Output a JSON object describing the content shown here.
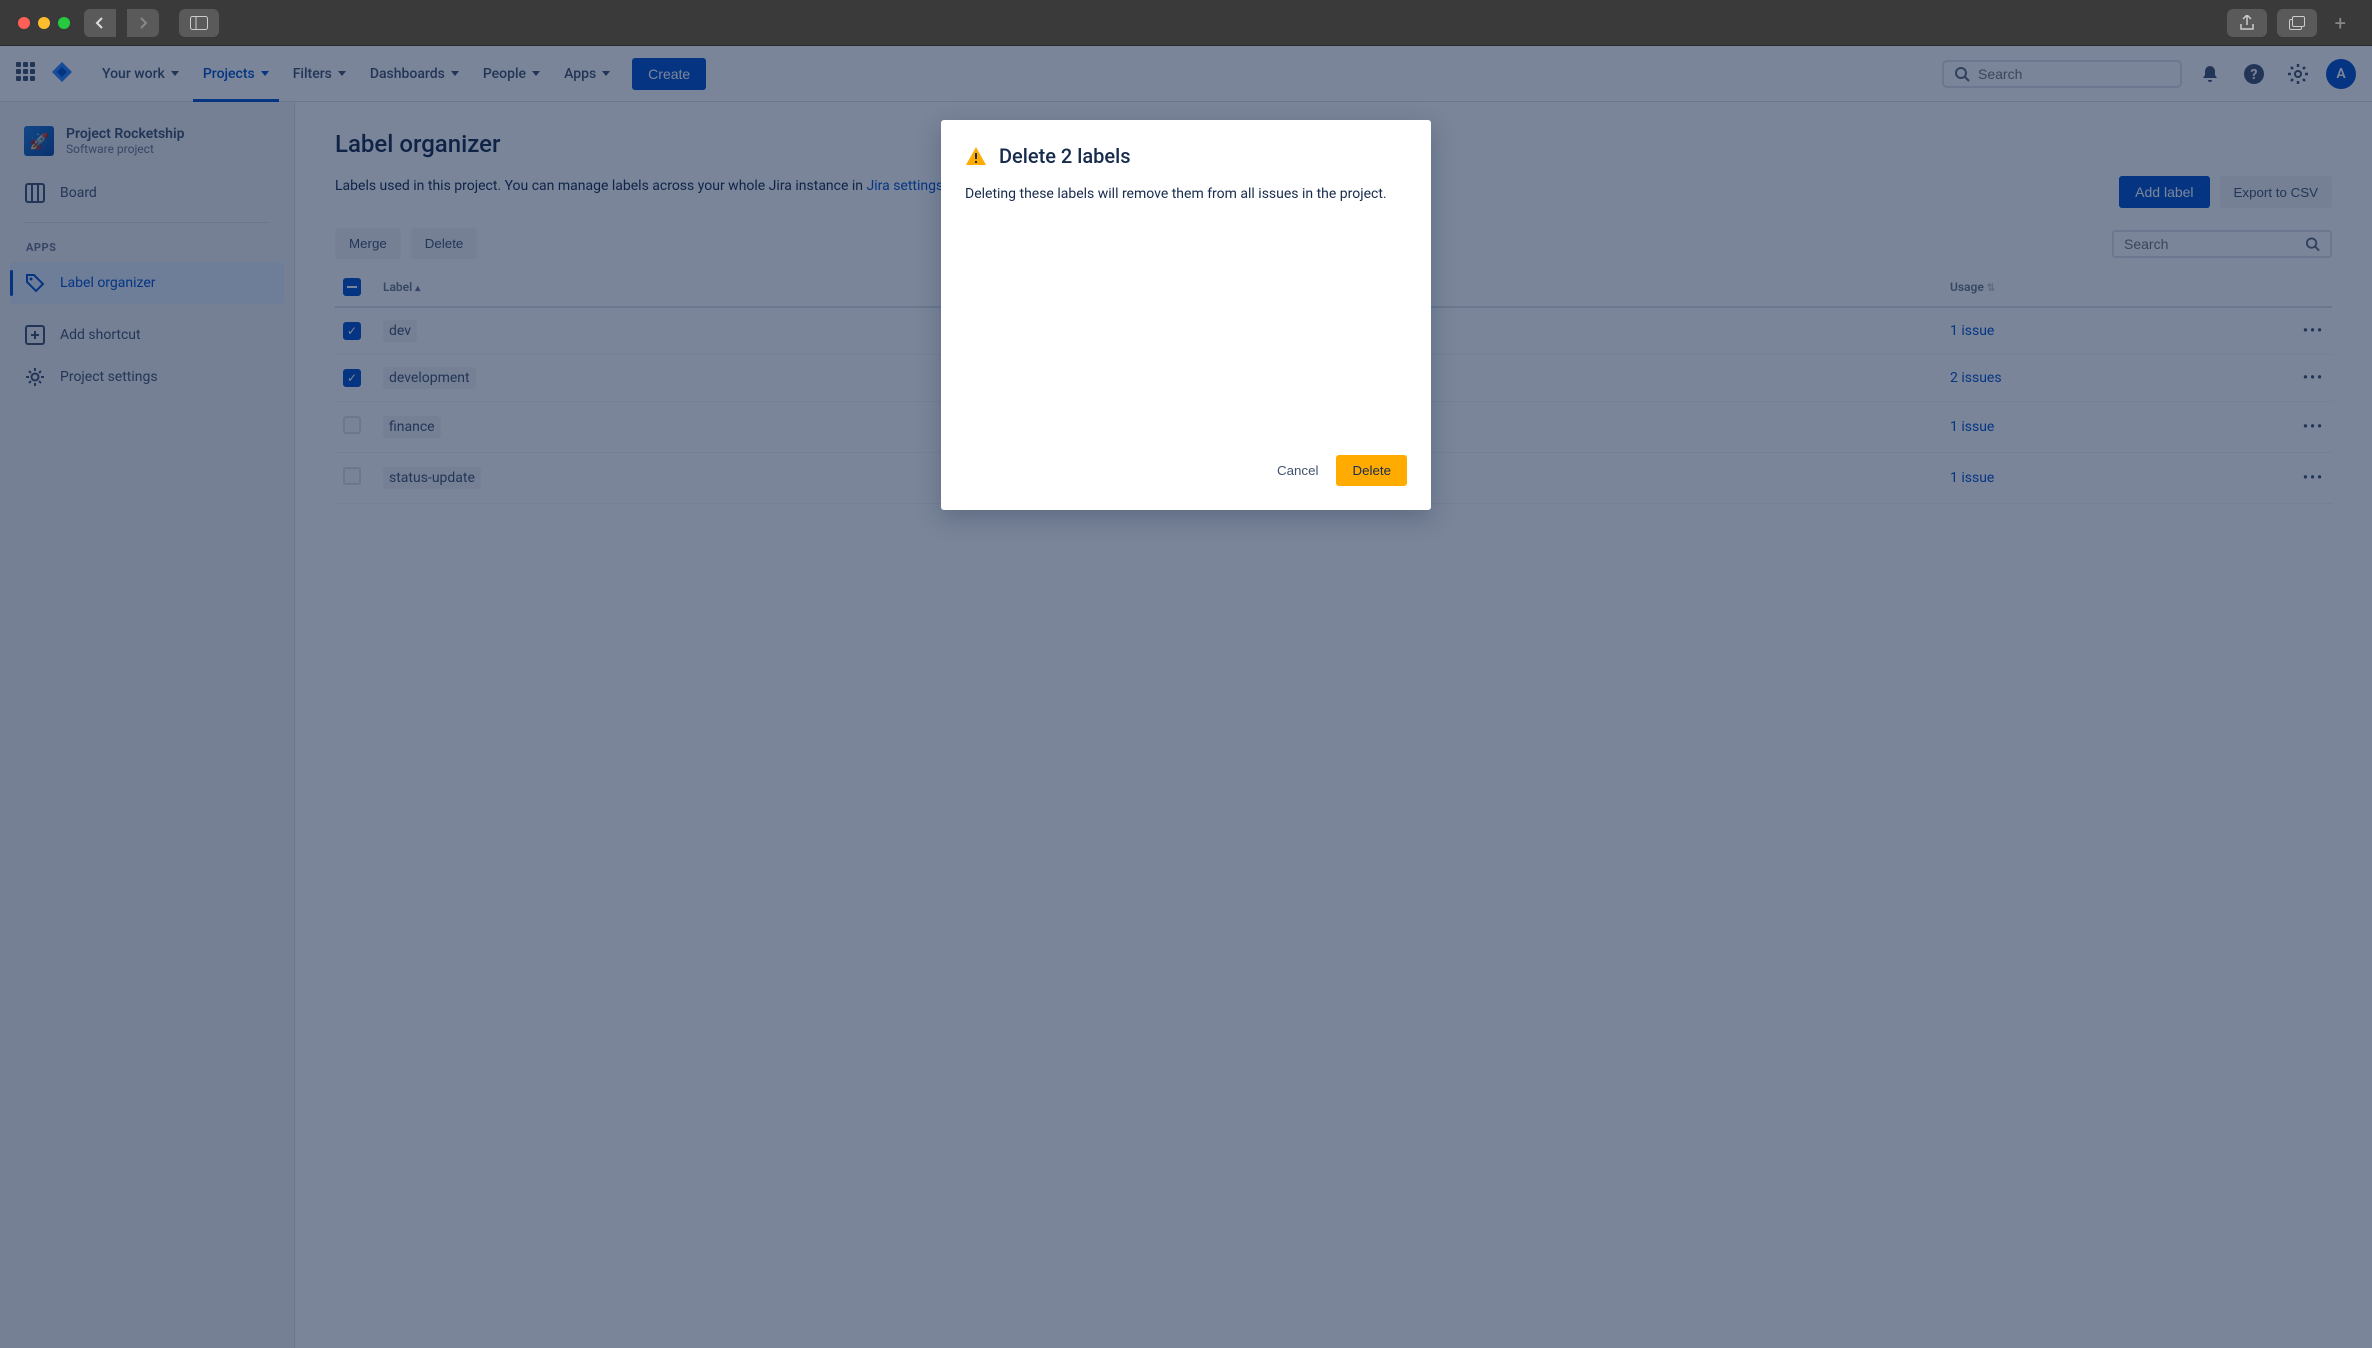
{
  "titlebar": {},
  "topnav": {
    "items": [
      {
        "label": "Your work"
      },
      {
        "label": "Projects"
      },
      {
        "label": "Filters"
      },
      {
        "label": "Dashboards"
      },
      {
        "label": "People"
      },
      {
        "label": "Apps"
      }
    ],
    "create_label": "Create",
    "search_placeholder": "Search",
    "avatar_initial": "A"
  },
  "sidebar": {
    "project_name": "Project Rocketship",
    "project_type": "Software project",
    "board_label": "Board",
    "apps_heading": "APPS",
    "label_organizer": "Label organizer",
    "add_shortcut": "Add shortcut",
    "project_settings": "Project settings"
  },
  "page": {
    "title": "Label organizer",
    "desc_prefix": "Labels used in this project. You can manage labels across your whole Jira instance in ",
    "desc_link": "Jira settings",
    "add_label": "Add label",
    "export_csv": "Export to CSV",
    "merge_btn": "Merge",
    "delete_btn": "Delete",
    "table_search_placeholder": "Search",
    "col_label": "Label",
    "col_usage": "Usage",
    "rows": [
      {
        "label": "dev",
        "usage": "1 issue",
        "checked": true
      },
      {
        "label": "development",
        "usage": "2 issues",
        "checked": true
      },
      {
        "label": "finance",
        "usage": "1 issue",
        "checked": false
      },
      {
        "label": "status-update",
        "usage": "1 issue",
        "checked": false
      }
    ]
  },
  "modal": {
    "title": "Delete 2 labels",
    "body": "Deleting these labels will remove them from all issues in the project.",
    "cancel": "Cancel",
    "delete": "Delete"
  }
}
